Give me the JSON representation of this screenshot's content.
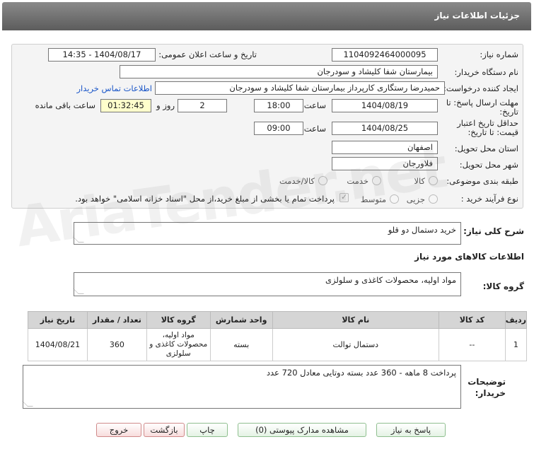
{
  "header": {
    "title": "جزئیات اطلاعات نیاز"
  },
  "form": {
    "need_number_label": "شماره نیاز:",
    "need_number": "1104092464000095",
    "announce_label": "تاریخ و ساعت اعلان عمومی:",
    "announce_value": "1404/08/17 - 14:35",
    "buyer_org_label": "نام دستگاه خریدار:",
    "buyer_org": "بیمارستان شفا کلیشاد و سودرجان",
    "creator_label": "ایجاد کننده درخواست:",
    "creator": "حمیدرضا رستگاری کارپرداز بیمارستان شفا کلیشاد و سودرجان",
    "contact_link": "اطلاعات تماس خریدار",
    "deadline_label_1": "مهلت ارسال پاسخ: تا",
    "deadline_label_2": "تاریخ:",
    "deadline_date": "1404/08/19",
    "time_label": "ساعت",
    "deadline_time": "18:00",
    "days_value": "2",
    "days_label": "روز و",
    "remaining_value": "01:32:45",
    "remaining_label": "ساعت باقی مانده",
    "validity_label_1": "حداقل تاریخ اعتبار",
    "validity_label_2": "قیمت: تا تاریخ:",
    "validity_date": "1404/08/25",
    "validity_time": "09:00",
    "province_label": "استان محل تحویل:",
    "province": "اصفهان",
    "city_label": "شهر محل تحویل:",
    "city": "فلاورجان",
    "category_label": "طبقه بندی موضوعی:",
    "category_options": [
      "کالا",
      "خدمت",
      "کالا/خدمت"
    ],
    "process_label": "نوع فرآیند خرید :",
    "process_options": [
      "جزیی",
      "متوسط"
    ],
    "payment_note": "پرداخت تمام یا بخشی از مبلغ خرید،از محل \"اسناد خزانه اسلامی\" خواهد بود."
  },
  "summary": {
    "label": "شرح کلی نیاز:",
    "value": "خرید دستمال دو قلو"
  },
  "goods": {
    "section_title": "اطلاعات کالاهای مورد نیاز",
    "group_label": "گروه کالا:",
    "group_value": "مواد اولیه، محصولات کاغذی و سلولزی"
  },
  "table": {
    "headers": [
      "ردیف",
      "کد کالا",
      "نام کالا",
      "واحد شمارش",
      "گروه کالا",
      "تعداد / مقدار",
      "تاریخ نیاز"
    ],
    "rows": [
      [
        "1",
        "--",
        "دستمال توالت",
        "بسته",
        "مواد اولیه، محصولات کاغذی و سلولزی",
        "360",
        "1404/08/21"
      ]
    ]
  },
  "notes": {
    "label_1": "توضیحات",
    "label_2": "خریدار:",
    "value": "پرداخت 8 ماهه - 360 عدد بسته دوتایی معادل 720 عدد"
  },
  "buttons": {
    "reply": "پاسخ به نیاز",
    "attachments": "مشاهده مدارک پیوستی (0)",
    "print": "چاپ",
    "back": "بازگشت",
    "exit": "خروج"
  },
  "watermark": "AriaTender.net"
}
